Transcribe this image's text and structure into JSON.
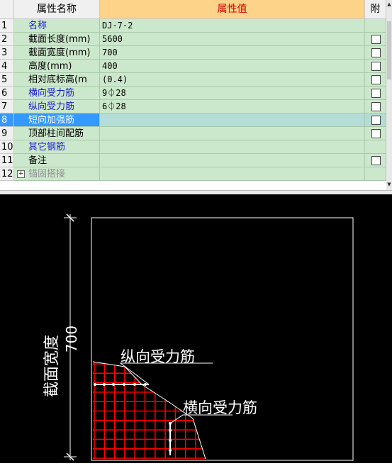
{
  "grid": {
    "headers": {
      "name": "属性名称",
      "value": "属性值",
      "attach": "附"
    },
    "rows": [
      {
        "index": "1",
        "name": "名称",
        "value": "DJ-7-2",
        "style": "blue",
        "checkbox": false
      },
      {
        "index": "2",
        "name": "截面长度(mm)",
        "value": "5600",
        "style": "normal",
        "checkbox": true
      },
      {
        "index": "3",
        "name": "截面宽度(mm)",
        "value": "700",
        "style": "normal",
        "checkbox": true
      },
      {
        "index": "4",
        "name": "高度(mm)",
        "value": "400",
        "style": "normal",
        "checkbox": true
      },
      {
        "index": "5",
        "name": "相对底标高(m",
        "value": "(0.4)",
        "style": "normal",
        "checkbox": true
      },
      {
        "index": "6",
        "name": "横向受力筋",
        "value": "9⏀28",
        "style": "blue",
        "checkbox": true
      },
      {
        "index": "7",
        "name": "纵向受力筋",
        "value": "6⏀28",
        "style": "blue",
        "checkbox": true
      },
      {
        "index": "8",
        "name": "短向加强筋",
        "value": "",
        "style": "selected",
        "checkbox": true
      },
      {
        "index": "9",
        "name": "顶部柱间配筋",
        "value": "",
        "style": "normal",
        "checkbox": true
      },
      {
        "index": "10",
        "name": "其它钢筋",
        "value": "",
        "style": "blue",
        "checkbox": false
      },
      {
        "index": "11",
        "name": "备注",
        "value": "",
        "style": "normal",
        "checkbox": true
      },
      {
        "index": "12",
        "name": "锚固搭接",
        "value": "",
        "style": "gray",
        "checkbox": false,
        "expand": "+"
      }
    ]
  },
  "drawing": {
    "dimension_label": "截面宽度",
    "dimension_value": "700",
    "label_longitudinal": "纵向受力筋",
    "label_transverse": "横向受力筋",
    "colors": {
      "background": "#000000",
      "outline": "#ffffff",
      "rebar": "#ff0000"
    }
  }
}
